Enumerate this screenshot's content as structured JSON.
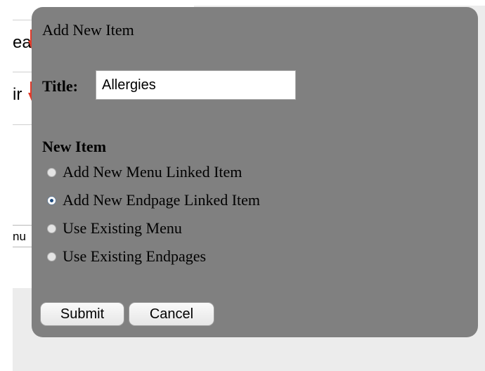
{
  "background": {
    "fragment_1": "ea",
    "fragment_2": "ir",
    "menu_fragment": "nu"
  },
  "dialog": {
    "title": "Add New Item",
    "title_label": "Title:",
    "title_value": "Allergies",
    "section_heading": "New Item",
    "options": [
      {
        "label": "Add New Menu Linked Item",
        "selected": false
      },
      {
        "label": "Add New Endpage Linked Item",
        "selected": true
      },
      {
        "label": "Use Existing Menu",
        "selected": false
      },
      {
        "label": "Use Existing Endpages",
        "selected": false
      }
    ],
    "submit_label": "Submit",
    "cancel_label": "Cancel"
  },
  "colors": {
    "dialog_background": "#808080",
    "page_background": "#ececec",
    "arrow": "#e03a2a"
  },
  "icons": {
    "arrow": "red-down-arrow-icon"
  }
}
